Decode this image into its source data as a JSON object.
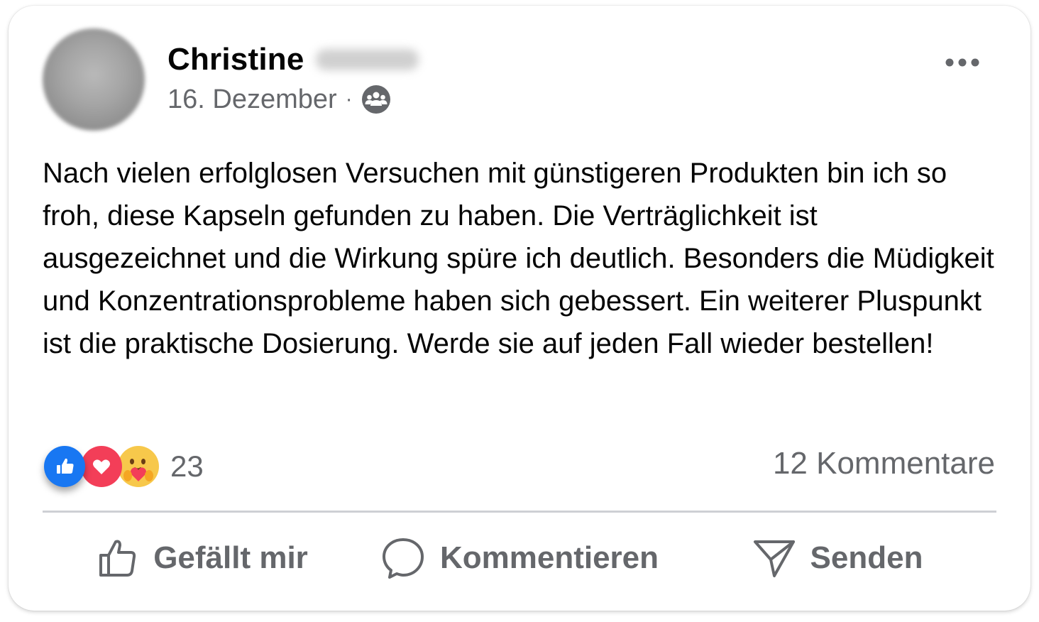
{
  "post": {
    "author_first_name": "Christine",
    "date": "16. Dezember",
    "separator": "·",
    "audience_icon": "friends-icon",
    "more_icon": "more-horizontal-icon",
    "text": "Nach vielen erfolglosen Versuchen mit günstigeren Produkten bin ich so froh, diese Kapseln gefunden zu haben. Die Verträglichkeit ist ausgezeichnet und die Wirkung spüre ich deutlich. Besonders die Müdigkeit und Konzentrationsprobleme haben sich gebessert. Ein weiterer Pluspunkt ist die praktische Dosierung. Werde sie auf jeden Fall wieder bestellen!"
  },
  "reactions": {
    "icons": [
      "like-reaction-icon",
      "love-reaction-icon",
      "care-reaction-icon"
    ],
    "count": "23"
  },
  "comments": {
    "count_label": "12 Kommentare"
  },
  "actions": {
    "like_label": "Gefällt mir",
    "comment_label": "Kommentieren",
    "share_label": "Senden"
  },
  "colors": {
    "text_primary": "#050505",
    "text_secondary": "#65676b",
    "like_blue": "#1877f2",
    "love_red": "#f33e58",
    "care_yellow": "#f7c84b",
    "divider": "#ced0d4"
  }
}
